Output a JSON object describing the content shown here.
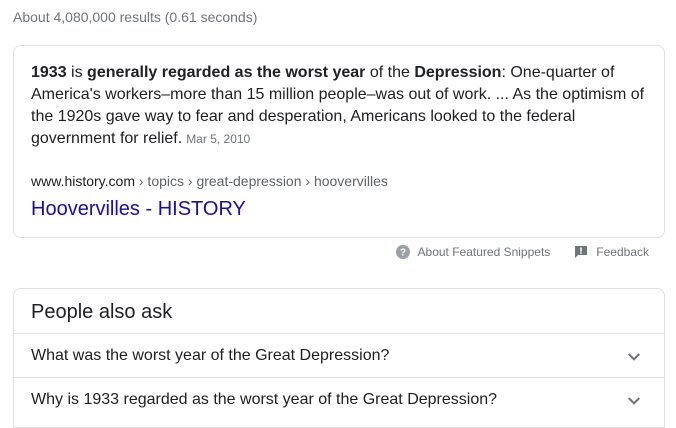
{
  "results_stats": "About 4,080,000 results (0.61 seconds)",
  "snippet": {
    "year": "1933",
    "t1": " is ",
    "bold_phrase": "generally regarded as the worst year",
    "t2": " of the ",
    "depression": "Depression",
    "t3": ": One-quarter of America's workers–more than 15 million people–was out of work. ... As the optimism of the 1920s gave way to fear and desperation, Americans looked to the federal government for relief.",
    "date": "Mar 5, 2010"
  },
  "source": {
    "domain": "www.history.com",
    "breadcrumb": " › topics › great-depression › hoovervilles",
    "title": "Hoovervilles - HISTORY"
  },
  "footer": {
    "about_label": "About Featured Snippets",
    "feedback_label": "Feedback",
    "about_icon": "help-circle-icon",
    "feedback_icon": "feedback-icon"
  },
  "people_also_ask": {
    "heading": "People also ask",
    "questions": [
      "What was the worst year of the Great Depression?",
      "Why is 1933 regarded as the worst year of the Great Depression?"
    ],
    "expand_icon": "chevron-down-icon"
  },
  "colors": {
    "link": "#1a0dab",
    "muted": "#70757a",
    "border": "#dfe1e5"
  }
}
